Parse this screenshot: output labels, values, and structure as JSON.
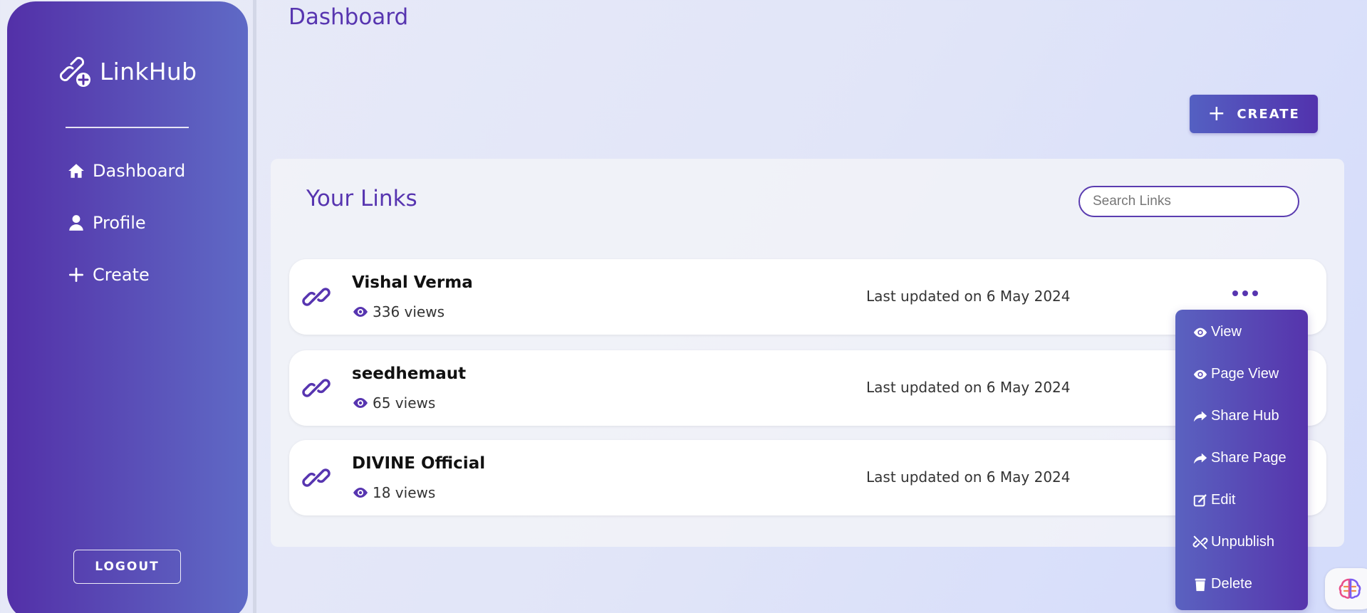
{
  "brand": {
    "name": "LinkHub"
  },
  "sidebar": {
    "items": [
      {
        "label": "Dashboard",
        "icon": "home-icon"
      },
      {
        "label": "Profile",
        "icon": "user-icon"
      },
      {
        "label": "Create",
        "icon": "plus-icon"
      }
    ],
    "logout_label": "LOGOUT"
  },
  "header": {
    "title": "Dashboard"
  },
  "toolbar": {
    "create_label": "CREATE"
  },
  "links": {
    "title": "Your Links",
    "search_placeholder": "Search Links",
    "items": [
      {
        "name": "Vishal Verma",
        "views": "336 views",
        "updated": "Last updated on 6 May 2024"
      },
      {
        "name": "seedhemaut",
        "views": "65 views",
        "updated": "Last updated on 6 May 2024"
      },
      {
        "name": "DIVINE Official",
        "views": "18 views",
        "updated": "Last updated on 6 May 2024"
      }
    ]
  },
  "menu": {
    "items": [
      {
        "label": "View",
        "icon": "eye-icon"
      },
      {
        "label": "Page View",
        "icon": "eye-icon"
      },
      {
        "label": "Share Hub",
        "icon": "share-icon"
      },
      {
        "label": "Share Page",
        "icon": "share-icon"
      },
      {
        "label": "Edit",
        "icon": "edit-icon"
      },
      {
        "label": "Unpublish",
        "icon": "unlink-icon"
      },
      {
        "label": "Delete",
        "icon": "trash-icon"
      }
    ]
  },
  "colors": {
    "accent": "#5735b0",
    "sidebar_start": "#5330a8",
    "sidebar_end": "#5f6ac6",
    "background": "#e1e5f8"
  }
}
